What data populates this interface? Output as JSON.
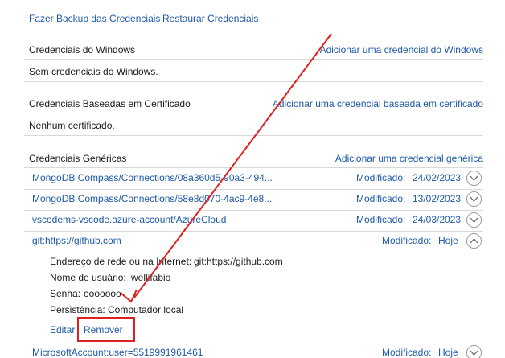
{
  "top_links": {
    "backup": "Fazer Backup das Credenciais",
    "restore": "Restaurar Credenciais"
  },
  "windows_section": {
    "title": "Credenciais do Windows",
    "add_link": "Adicionar uma credencial do Windows",
    "empty": "Sem credenciais do Windows."
  },
  "cert_section": {
    "title": "Credenciais Baseadas em Certificado",
    "add_link": "Adicionar uma credencial baseada em certificado",
    "empty": "Nenhum certificado."
  },
  "generic_section": {
    "title": "Credenciais Genéricas",
    "add_link": "Adicionar uma credencial genérica",
    "items": [
      {
        "name": "MongoDB Compass/Connections/08a360d5-90a3-494...",
        "modified_label": "Modificado:",
        "date": "24/02/2023"
      },
      {
        "name": "MongoDB Compass/Connections/58e8d070-4ac9-4e8...",
        "modified_label": "Modificado:",
        "date": "13/02/2023"
      },
      {
        "name": "vscodems-vscode.azure-account/AzureCloud",
        "modified_label": "Modificado:",
        "date": "24/03/2023"
      },
      {
        "name": "git:https://github.com",
        "modified_label": "Modificado:",
        "date": "Hoje"
      }
    ],
    "expanded": {
      "address_label": "Endereço de rede ou na Internet:",
      "address_value": "git:https://github.com",
      "user_label": "Nome de usuário:",
      "user_value": "wellifabio",
      "password_label": "Senha:",
      "password_value": "ooooooo",
      "persistence_label": "Persistência:",
      "persistence_value": "Computador local",
      "edit": "Editar",
      "remove": "Remover"
    },
    "last_item": {
      "name": "MicrosoftAccount:user=5519991961461",
      "modified_label": "Modificado:",
      "date": "Hoje"
    }
  },
  "colors": {
    "link": "#1e5aa8",
    "annotation": "#e02020"
  }
}
